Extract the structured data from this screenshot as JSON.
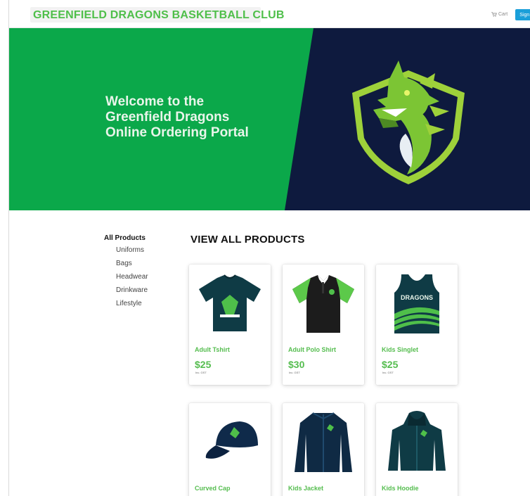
{
  "header": {
    "brand": "GREENFIELD DRAGONS BASKETBALL CLUB",
    "cart_label": "Cart",
    "signin_label": "Sign in"
  },
  "hero": {
    "line1": "Welcome to the",
    "line2": "Greenfield Dragons",
    "line3": "Online Ordering Portal"
  },
  "sidebar": {
    "all_label": "All Products",
    "items": [
      {
        "label": "Uniforms"
      },
      {
        "label": "Bags"
      },
      {
        "label": "Headwear"
      },
      {
        "label": "Drinkware"
      },
      {
        "label": "Lifestyle"
      }
    ]
  },
  "main": {
    "title": "VIEW ALL PRODUCTS",
    "products": [
      {
        "name": "Adult Tshirt",
        "price": "$25",
        "gst": "Inc. GST",
        "icon": "tshirt-icon"
      },
      {
        "name": "Adult Polo Shirt",
        "price": "$30",
        "gst": "Inc. GST",
        "icon": "polo-shirt-icon"
      },
      {
        "name": "Kids Singlet",
        "price": "$25",
        "gst": "Inc. GST",
        "icon": "singlet-icon"
      },
      {
        "name": "Curved Cap",
        "icon": "cap-icon"
      },
      {
        "name": "Kids Jacket",
        "icon": "jacket-icon"
      },
      {
        "name": "Kids Hoodie",
        "icon": "hoodie-icon"
      }
    ]
  },
  "colors": {
    "brand_green": "#4fbf4a",
    "hero_green": "#0ba84a",
    "hero_navy": "#0e1a3e",
    "signin_blue": "#1a9fd9"
  }
}
